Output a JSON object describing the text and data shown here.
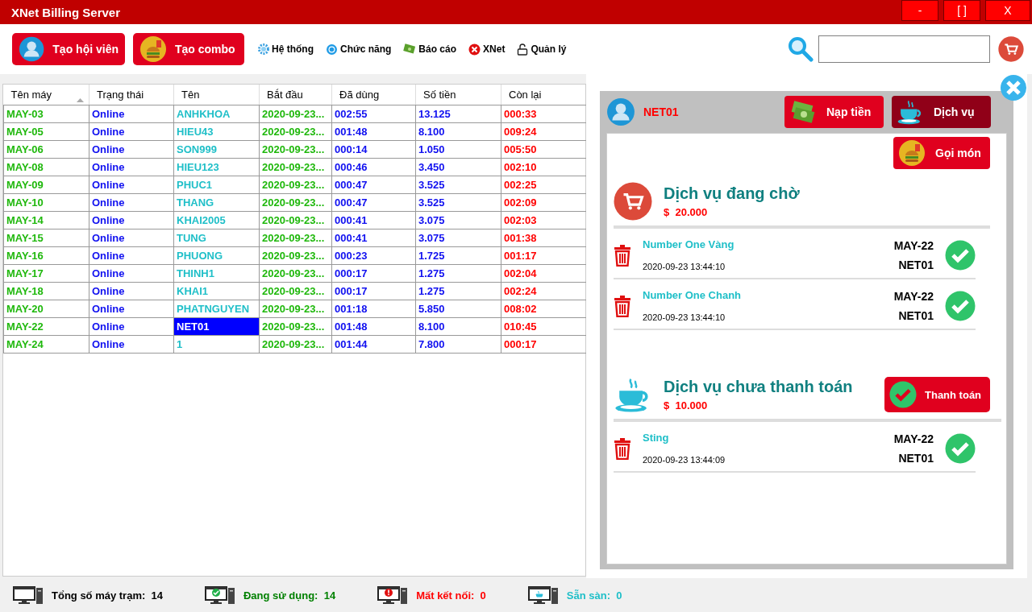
{
  "window": {
    "title": "XNet Billing Server",
    "controls": [
      {
        "kind": "minimize",
        "label": "-"
      },
      {
        "kind": "maximize",
        "label": "[ ]"
      },
      {
        "kind": "close",
        "label": "X"
      }
    ]
  },
  "toolbar": {
    "buttons": [
      {
        "kind": "member",
        "label": "Tạo hội viên"
      },
      {
        "kind": "combo",
        "label": "Tạo combo"
      }
    ],
    "menus": [
      {
        "kind": "gear",
        "label": "Hệ thống"
      },
      {
        "kind": "circle",
        "label": "Chức năng"
      },
      {
        "kind": "money",
        "label": "Báo cáo"
      },
      {
        "kind": "x",
        "label": "XNet"
      },
      {
        "kind": "lock",
        "label": "Quản lý"
      }
    ]
  },
  "table": {
    "columns": [
      {
        "label": "Tên máy",
        "sorted": true
      },
      {
        "label": "Trạng thái",
        "sorted": false
      },
      {
        "label": "Tên",
        "sorted": false
      },
      {
        "label": "Bắt đầu",
        "sorted": false
      },
      {
        "label": "Đã dùng",
        "sorted": false
      },
      {
        "label": "Số tiền",
        "sorted": false
      },
      {
        "label": "Còn lại",
        "sorted": false
      }
    ],
    "rows": [
      {
        "cells": [
          "MAY-03",
          "Online",
          "ANHKHOA",
          "2020-09-23...",
          "002:55",
          "13.125",
          "000:33"
        ],
        "selected": false
      },
      {
        "cells": [
          "MAY-05",
          "Online",
          "HIEU43",
          "2020-09-23...",
          "001:48",
          "8.100",
          "009:24"
        ],
        "selected": false
      },
      {
        "cells": [
          "MAY-06",
          "Online",
          "SON999",
          "2020-09-23...",
          "000:14",
          "1.050",
          "005:50"
        ],
        "selected": false
      },
      {
        "cells": [
          "MAY-08",
          "Online",
          "HIEU123",
          "2020-09-23...",
          "000:46",
          "3.450",
          "002:10"
        ],
        "selected": false
      },
      {
        "cells": [
          "MAY-09",
          "Online",
          "PHUC1",
          "2020-09-23...",
          "000:47",
          "3.525",
          "002:25"
        ],
        "selected": false
      },
      {
        "cells": [
          "MAY-10",
          "Online",
          "THANG",
          "2020-09-23...",
          "000:47",
          "3.525",
          "002:09"
        ],
        "selected": false
      },
      {
        "cells": [
          "MAY-14",
          "Online",
          "KHAI2005",
          "2020-09-23...",
          "000:41",
          "3.075",
          "002:03"
        ],
        "selected": false
      },
      {
        "cells": [
          "MAY-15",
          "Online",
          "TUNG",
          "2020-09-23...",
          "000:41",
          "3.075",
          "001:38"
        ],
        "selected": false
      },
      {
        "cells": [
          "MAY-16",
          "Online",
          "PHUONG",
          "2020-09-23...",
          "000:23",
          "1.725",
          "001:17"
        ],
        "selected": false
      },
      {
        "cells": [
          "MAY-17",
          "Online",
          "THINH1",
          "2020-09-23...",
          "000:17",
          "1.275",
          "002:04"
        ],
        "selected": false
      },
      {
        "cells": [
          "MAY-18",
          "Online",
          "KHAI1",
          "2020-09-23...",
          "000:17",
          "1.275",
          "002:24"
        ],
        "selected": false
      },
      {
        "cells": [
          "MAY-20",
          "Online",
          "PHATNGUYEN",
          "2020-09-23...",
          "001:18",
          "5.850",
          "008:02"
        ],
        "selected": false
      },
      {
        "cells": [
          "MAY-22",
          "Online",
          "NET01",
          "2020-09-23...",
          "001:48",
          "8.100",
          "010:45"
        ],
        "selected": true
      },
      {
        "cells": [
          "MAY-24",
          "Online",
          "1",
          "2020-09-23...",
          "001:44",
          "7.800",
          "000:17"
        ],
        "selected": false
      }
    ]
  },
  "panel": {
    "user": "NET01",
    "tabs": [
      {
        "kind": "money",
        "label": "Nạp tiền",
        "selected": false
      },
      {
        "kind": "cup",
        "label": "Dịch vụ",
        "selected": true
      }
    ],
    "order_button": "Gọi món",
    "sections": [
      {
        "kind": "pending",
        "title": "Dịch vụ đang chờ",
        "total": "$  20.000",
        "items": [
          {
            "name": "Number One Vàng",
            "time": "2020-09-23 13:44:10",
            "machine": "MAY-22",
            "user": "NET01"
          },
          {
            "name": "Number One Chanh",
            "time": "2020-09-23 13:44:10",
            "machine": "MAY-22",
            "user": "NET01"
          }
        ]
      },
      {
        "kind": "unpaid",
        "title": "Dịch vụ chưa thanh toán",
        "total": "$  10.000",
        "action": "Thanh toán",
        "items": [
          {
            "name": "Sting",
            "time": "2020-09-23 13:44:09",
            "machine": "MAY-22",
            "user": "NET01"
          }
        ]
      }
    ]
  },
  "status_bar": [
    {
      "kind": "total",
      "label": "Tổng số máy trạm:",
      "value": "14",
      "color": "#000000"
    },
    {
      "kind": "using",
      "label": "Đang sử dụng:",
      "value": "14",
      "color": "#008000"
    },
    {
      "kind": "lost",
      "label": "Mất kết nối:",
      "value": "0",
      "color": "#ff0000"
    },
    {
      "kind": "free",
      "label": "Sẵn sàn:",
      "value": "0",
      "color": "#1fbfc8"
    }
  ]
}
